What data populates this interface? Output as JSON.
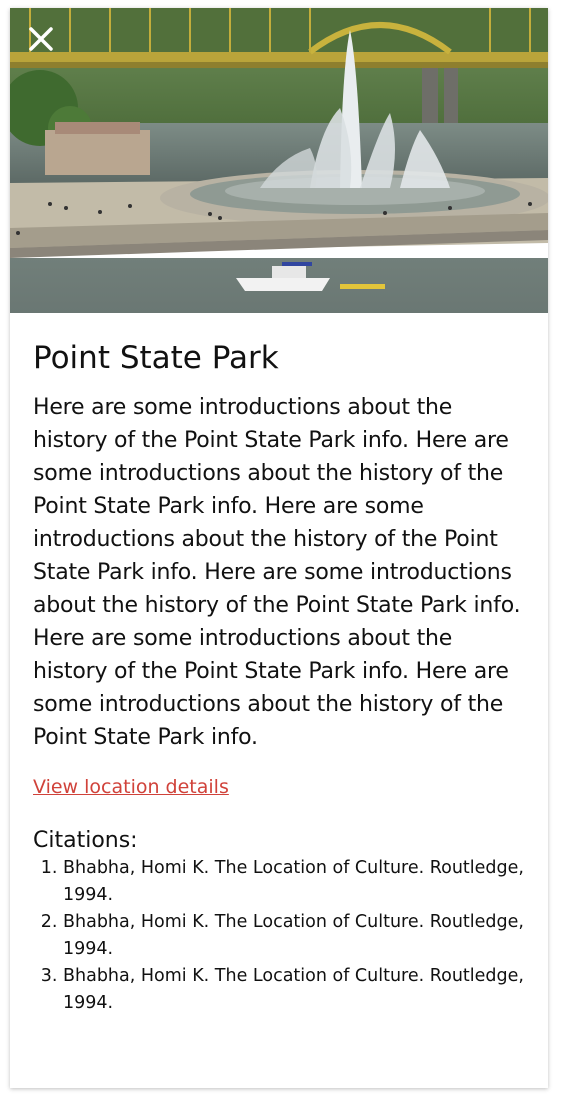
{
  "hero": {
    "alt": "Point State Park fountain"
  },
  "close": {
    "icon": "close-icon"
  },
  "place": {
    "title": "Point State Park",
    "description": "Here are some introductions about the history of the Point State Park info. Here are some introductions about the history of the Point State Park info. Here are some introductions about the history of the Point State Park info. Here are some introductions about the history of the Point State Park info. Here are some introductions about the history of the Point State Park info. Here are some introductions about the history of the Point State Park info.",
    "link_label": "View location details"
  },
  "citations": {
    "heading": "Citations:",
    "items": [
      "Bhabha, Homi K. The Location of Culture. Routledge, 1994.",
      "Bhabha, Homi K. The Location of Culture. Routledge, 1994.",
      "Bhabha, Homi K. The Location of Culture. Routledge, 1994."
    ]
  },
  "colors": {
    "link": "#d0423a",
    "text": "#111111"
  }
}
